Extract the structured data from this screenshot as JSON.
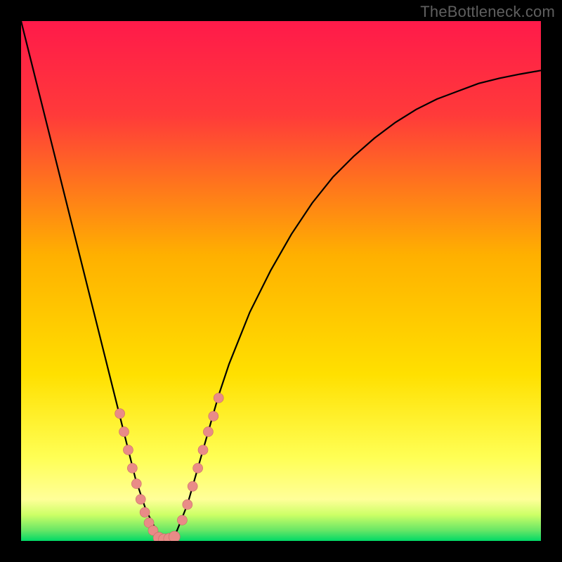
{
  "attribution": "TheBottleneck.com",
  "colors": {
    "bg_black": "#000000",
    "grad_top": "#ff1a4a",
    "grad_mid": "#ffd400",
    "grad_low": "#ffff66",
    "grad_band": "#ccff66",
    "grad_bottom": "#00e676",
    "curve": "#000000",
    "marker_fill": "#e98b87",
    "marker_stroke": "#c96b67",
    "attribution_text": "#5f5f5f"
  },
  "chart_data": {
    "type": "line",
    "title": "",
    "xlabel": "",
    "ylabel": "",
    "xlim": [
      0,
      100
    ],
    "ylim": [
      0,
      100
    ],
    "series": [
      {
        "name": "bottleneck-curve",
        "x": [
          0,
          2,
          4,
          6,
          8,
          10,
          12,
          14,
          16,
          18,
          20,
          22,
          24,
          26,
          27,
          28,
          29,
          30,
          32,
          34,
          36,
          38,
          40,
          44,
          48,
          52,
          56,
          60,
          64,
          68,
          72,
          76,
          80,
          84,
          88,
          92,
          96,
          100
        ],
        "y": [
          100,
          92,
          84,
          76,
          68,
          60,
          52,
          44,
          36,
          28,
          20,
          12,
          6,
          2,
          0.5,
          0,
          0.5,
          2,
          7,
          14,
          21,
          28,
          34,
          44,
          52,
          59,
          65,
          70,
          74,
          77.5,
          80.5,
          83,
          85,
          86.5,
          88,
          89,
          89.8,
          90.5
        ]
      }
    ],
    "markers_left": [
      {
        "x": 19.0,
        "y": 24.5
      },
      {
        "x": 19.8,
        "y": 21.0
      },
      {
        "x": 20.6,
        "y": 17.5
      },
      {
        "x": 21.4,
        "y": 14.0
      },
      {
        "x": 22.2,
        "y": 11.0
      },
      {
        "x": 23.0,
        "y": 8.0
      },
      {
        "x": 23.8,
        "y": 5.5
      },
      {
        "x": 24.6,
        "y": 3.5
      },
      {
        "x": 25.4,
        "y": 2.0
      }
    ],
    "markers_bottom": [
      {
        "x": 26.5,
        "y": 0.6
      },
      {
        "x": 27.5,
        "y": 0.3
      },
      {
        "x": 28.5,
        "y": 0.4
      },
      {
        "x": 29.5,
        "y": 0.8
      }
    ],
    "markers_right": [
      {
        "x": 31.0,
        "y": 4.0
      },
      {
        "x": 32.0,
        "y": 7.0
      },
      {
        "x": 33.0,
        "y": 10.5
      },
      {
        "x": 34.0,
        "y": 14.0
      },
      {
        "x": 35.0,
        "y": 17.5
      },
      {
        "x": 36.0,
        "y": 21.0
      },
      {
        "x": 37.0,
        "y": 24.0
      },
      {
        "x": 38.0,
        "y": 27.5
      }
    ],
    "gradient_stops": [
      {
        "offset": 0,
        "color": "#ff1a4a"
      },
      {
        "offset": 18,
        "color": "#ff3a3a"
      },
      {
        "offset": 45,
        "color": "#ffb000"
      },
      {
        "offset": 68,
        "color": "#ffe000"
      },
      {
        "offset": 84,
        "color": "#ffff55"
      },
      {
        "offset": 92,
        "color": "#ffff99"
      },
      {
        "offset": 95,
        "color": "#ccff66"
      },
      {
        "offset": 98,
        "color": "#66e666"
      },
      {
        "offset": 100,
        "color": "#00d966"
      }
    ]
  }
}
